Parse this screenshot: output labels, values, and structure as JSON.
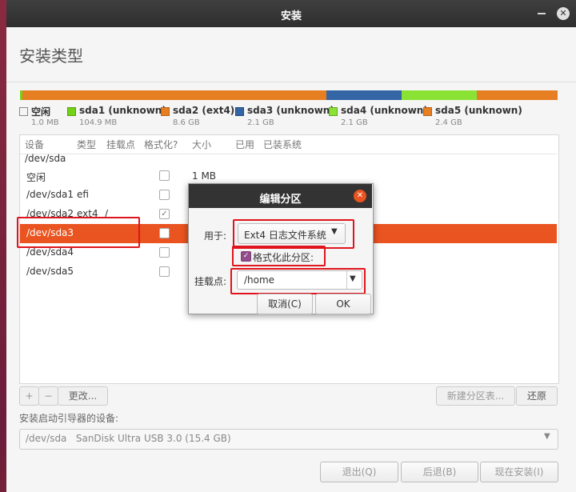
{
  "window": {
    "title": "安装"
  },
  "page": {
    "title": "安装类型"
  },
  "partition_bar": [
    {
      "color": "#ffffff",
      "frac": 0.002,
      "stripe": false
    },
    {
      "color": "#73d216",
      "frac": 0.004,
      "stripe": false
    },
    {
      "color": "#e67e22",
      "frac": 0.565,
      "stripe": true
    },
    {
      "color": "#3465a4",
      "frac": 0.14,
      "stripe": true
    },
    {
      "color": "#8ae234",
      "frac": 0.14,
      "stripe": true
    },
    {
      "color": "#e67e22",
      "frac": 0.149,
      "stripe": true
    }
  ],
  "legend": [
    {
      "name": "空闲",
      "size": "1.0 MB",
      "color": "#ffffff"
    },
    {
      "name": "sda1 (unknown)",
      "size": "104.9 MB",
      "color": "#73d216"
    },
    {
      "name": "sda2 (ext4)",
      "size": "8.6 GB",
      "color": "#e67e22"
    },
    {
      "name": "sda3 (unknown)",
      "size": "2.1 GB",
      "color": "#3465a4"
    },
    {
      "name": "sda4 (unknown)",
      "size": "2.1 GB",
      "color": "#8ae234"
    },
    {
      "name": "sda5 (unknown)",
      "size": "2.4 GB",
      "color": "#e67e22"
    }
  ],
  "table": {
    "headers": [
      "设备",
      "类型",
      "挂载点",
      "格式化?",
      "大小",
      "已用",
      "已装系统"
    ],
    "disk": "/dev/sda",
    "rows": [
      {
        "device": "空闲",
        "type": "",
        "mount": "",
        "format": false,
        "size": "1 MB"
      },
      {
        "device": "/dev/sda1",
        "type": "efi",
        "mount": "",
        "format": false,
        "size": ""
      },
      {
        "device": "/dev/sda2",
        "type": "ext4",
        "mount": "/",
        "format": true,
        "size": ""
      },
      {
        "device": "/dev/sda3",
        "type": "",
        "mount": "",
        "format": false,
        "size": "",
        "selected": true
      },
      {
        "device": "/dev/sda4",
        "type": "",
        "mount": "",
        "format": false,
        "size": ""
      },
      {
        "device": "/dev/sda5",
        "type": "",
        "mount": "",
        "format": false,
        "size": ""
      }
    ]
  },
  "toolbar": {
    "add": "+",
    "remove": "−",
    "change": "更改...",
    "new_table": "新建分区表...",
    "revert": "还原"
  },
  "bootloader": {
    "label": "安装启动引导器的设备:",
    "device": "/dev/sda   SanDisk Ultra USB 3.0 (15.4 GB)"
  },
  "buttons": {
    "quit": "退出(Q)",
    "back": "后退(B)",
    "install": "现在安装(I)"
  },
  "dialog": {
    "title": "编辑分区",
    "use_label": "用于:",
    "use_value": "Ext4 日志文件系统",
    "format_label": "格式化此分区:",
    "format_checked": true,
    "mount_label": "挂载点:",
    "mount_value": "/home",
    "cancel": "取消(C)",
    "ok": "OK"
  },
  "colors": {
    "accent": "#e95420",
    "highlight": "#e0141c"
  }
}
